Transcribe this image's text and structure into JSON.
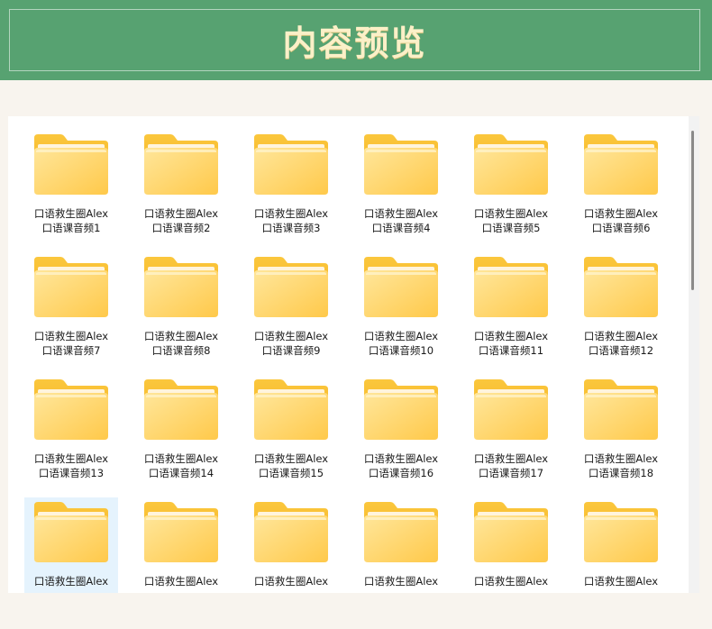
{
  "header": {
    "title": "内容预览"
  },
  "folders": [
    {
      "line1": "口语救生圈Alex",
      "line2": "口语课音频1"
    },
    {
      "line1": "口语救生圈Alex",
      "line2": "口语课音频2"
    },
    {
      "line1": "口语救生圈Alex",
      "line2": "口语课音频3"
    },
    {
      "line1": "口语救生圈Alex",
      "line2": "口语课音频4"
    },
    {
      "line1": "口语救生圈Alex",
      "line2": "口语课音频5"
    },
    {
      "line1": "口语救生圈Alex",
      "line2": "口语课音频6"
    },
    {
      "line1": "口语救生圈Alex",
      "line2": "口语课音频7"
    },
    {
      "line1": "口语救生圈Alex",
      "line2": "口语课音频8"
    },
    {
      "line1": "口语救生圈Alex",
      "line2": "口语课音频9"
    },
    {
      "line1": "口语救生圈Alex",
      "line2": "口语课音频10"
    },
    {
      "line1": "口语救生圈Alex",
      "line2": "口语课音频11"
    },
    {
      "line1": "口语救生圈Alex",
      "line2": "口语课音频12"
    },
    {
      "line1": "口语救生圈Alex",
      "line2": "口语课音频13"
    },
    {
      "line1": "口语救生圈Alex",
      "line2": "口语课音频14"
    },
    {
      "line1": "口语救生圈Alex",
      "line2": "口语课音频15"
    },
    {
      "line1": "口语救生圈Alex",
      "line2": "口语课音频16"
    },
    {
      "line1": "口语救生圈Alex",
      "line2": "口语课音频17"
    },
    {
      "line1": "口语救生圈Alex",
      "line2": "口语课音频18"
    },
    {
      "line1": "口语救生圈Alex",
      "line2": ""
    },
    {
      "line1": "口语救生圈Alex",
      "line2": ""
    },
    {
      "line1": "口语救生圈Alex",
      "line2": ""
    },
    {
      "line1": "口语救生圈Alex",
      "line2": ""
    },
    {
      "line1": "口语救生圈Alex",
      "line2": ""
    },
    {
      "line1": "口语救生圈Alex",
      "line2": ""
    }
  ],
  "selected_index": 18,
  "icon": "folder-icon",
  "colors": {
    "banner": "#57a271",
    "title": "#fbf0c8",
    "folder_back": "#f6b826",
    "folder_front": "#ffd866",
    "selection": "#e5f3fd"
  }
}
